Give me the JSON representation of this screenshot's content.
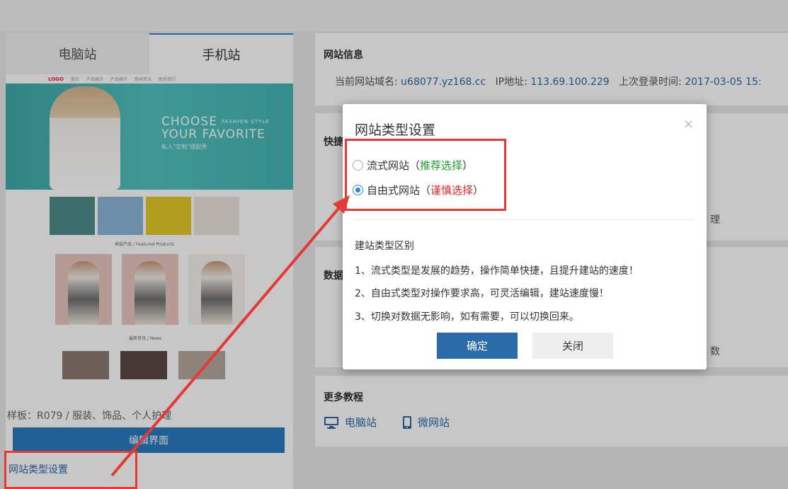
{
  "tabs": [
    "电脑站",
    "手机站"
  ],
  "preview": {
    "logo": "LOGO",
    "nav_items": [
      "首页",
      "产品展示",
      "产品展示",
      "新闻资讯",
      "联系我们"
    ],
    "banner_line1": "CHOOSE",
    "banner_line1b": "FASHION STYLE",
    "banner_line2": "YOUR FAVORITE",
    "banner_sub": "私人“定制”搭配秀",
    "section1": "表装产品 / Featured Products",
    "section2": "最新资讯 / News"
  },
  "left": {
    "template_text": "样板：R079 / 服装、饰品、个人护理",
    "edit_button": "编辑界面",
    "site_type_link": "网站类型设置"
  },
  "site_info": {
    "title": "网站信息",
    "domain_label": "当前网站域名:",
    "domain": "u68077.yz168.cc",
    "ip_label": "IP地址:",
    "ip": "113.69.100.229",
    "login_label": "上次登录时间:",
    "login_time": "2017-03-05 15:"
  },
  "fragments": {
    "quick": "快捷",
    "data": "数据",
    "manage": "理",
    "count": "数"
  },
  "more": {
    "title": "更多教程",
    "pc": "电脑站",
    "mobile": "微网站"
  },
  "modal": {
    "title": "网站类型设置",
    "close": "×",
    "opt1": "流式网站（",
    "opt1_hint": "推荐选择",
    "opt1_end": "）",
    "opt2": "自由式网站（",
    "opt2_hint": "谨慎选择",
    "opt2_end": "）",
    "diff_title": "建站类型区别",
    "diff1": "1、流式类型是发展的趋势，操作简单快捷，且提升建站的速度！",
    "diff2": "2、自由式类型对操作要求高，可灵活编辑，建站速度慢！",
    "diff3": "3、切换对数据无影响，如有需要，可以切换回来。",
    "ok": "确定",
    "cancel": "关闭"
  },
  "colors": {
    "accent": "#2b6aa8",
    "highlight": "#e53935",
    "green": "#1e9e2f"
  }
}
